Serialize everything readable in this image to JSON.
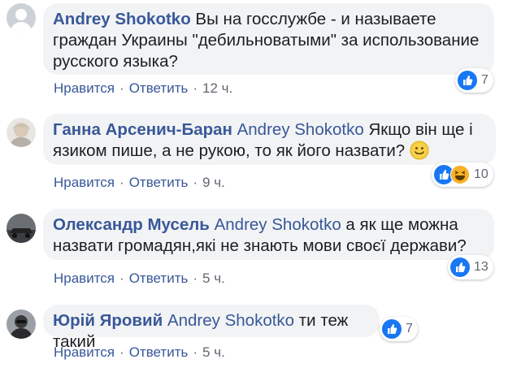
{
  "comments": [
    {
      "author": "Andrey Shokotko",
      "mention": "",
      "text_line1": "Вы на госслужбе - и называете",
      "text_line2": "граждан Украины \"дебильноватыми\" за использование",
      "text_line3": "русского языка?",
      "like_label": "Нравится",
      "reply_label": "Ответить",
      "time": "12 ч.",
      "reaction_count": "7",
      "reaction_icons": [
        "like-icon"
      ]
    },
    {
      "author": "Ганна Арсенич-Баран",
      "mention": "Andrey Shokotko",
      "text_line1": "Якщо він ще і",
      "text_line2": "язиком пише, а не рукою, то як його назвати?",
      "like_label": "Нравится",
      "reply_label": "Ответить",
      "time": "9 ч.",
      "reaction_count": "10",
      "reaction_icons": [
        "like-icon",
        "haha-icon"
      ],
      "inline_emoji": "smile-emoji-icon"
    },
    {
      "author": "Олександр Мусель",
      "mention": "Andrey Shokotko",
      "text_line1": "а як ще можна",
      "text_line2": "назвати громадян,які не знають мови своєї держави?",
      "like_label": "Нравится",
      "reply_label": "Ответить",
      "time": "5 ч.",
      "reaction_count": "13",
      "reaction_icons": [
        "like-icon"
      ]
    },
    {
      "author": "Юрій Яровий",
      "mention": "Andrey Shokotko",
      "text_line1": "ти теж такий",
      "like_label": "Нравится",
      "reply_label": "Ответить",
      "time": "5 ч.",
      "reaction_count": "7",
      "reaction_icons": [
        "like-icon"
      ]
    }
  ],
  "separator": "·",
  "colors": {
    "link": "#385898",
    "bubble": "#f2f3f5",
    "like_blue": "#1877f2",
    "haha_yellow": "#f7b125",
    "meta_gray": "#606770"
  }
}
